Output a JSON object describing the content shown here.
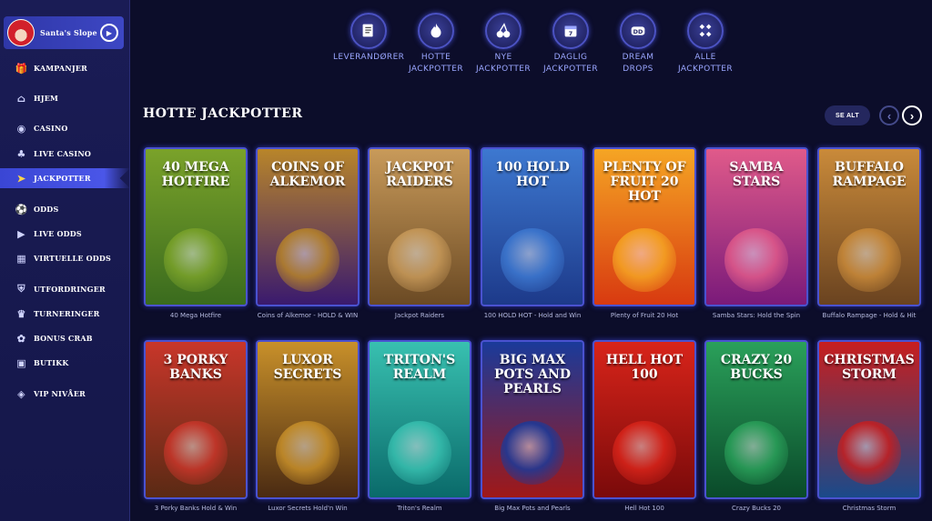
{
  "user": {
    "name": "Santa's Slope"
  },
  "sidebar": {
    "items": [
      {
        "label": "KAMPANJER",
        "icon": "gift-icon"
      },
      {
        "label": "HJEM",
        "icon": "home-icon"
      },
      {
        "label": "CASINO",
        "icon": "casino-chip-icon"
      },
      {
        "label": "LIVE CASINO",
        "icon": "live-casino-icon"
      },
      {
        "label": "JACKPOTTER",
        "icon": "jackpot-icon",
        "active": true
      },
      {
        "label": "ODDS",
        "icon": "football-icon"
      },
      {
        "label": "LIVE ODDS",
        "icon": "play-icon"
      },
      {
        "label": "VIRTUELLE ODDS",
        "icon": "virtual-icon"
      },
      {
        "label": "UTFORDRINGER",
        "icon": "shield-icon"
      },
      {
        "label": "TURNERINGER",
        "icon": "trophy-icon"
      },
      {
        "label": "BONUS CRAB",
        "icon": "crab-icon"
      },
      {
        "label": "BUTIKK",
        "icon": "shop-icon"
      },
      {
        "label": "VIP NIVÅER",
        "icon": "vip-icon"
      }
    ]
  },
  "categories": [
    {
      "label_1": "LEVERANDØRER",
      "label_2": "",
      "icon": "provider-icon"
    },
    {
      "label_1": "HOTTE",
      "label_2": "JACKPOTTER",
      "icon": "flame-icon"
    },
    {
      "label_1": "NYE",
      "label_2": "JACKPOTTER",
      "icon": "cherries-icon"
    },
    {
      "label_1": "DAGLIG",
      "label_2": "JACKPOTTER",
      "icon": "calendar-icon"
    },
    {
      "label_1": "DREAM",
      "label_2": "DROPS",
      "icon": "dream-drops-icon"
    },
    {
      "label_1": "ALLE",
      "label_2": "JACKPOTTER",
      "icon": "grid-icon"
    }
  ],
  "section": {
    "title": "HOTTE JACKPOTTER",
    "see_all": "SE ALT"
  },
  "games_row1": [
    {
      "title": "40 MEGA HOTFIRE",
      "caption": "40 Mega Hotfire",
      "color1": "#3a6b1e",
      "color2": "#7aa22a"
    },
    {
      "title": "COINS OF ALKEMOR",
      "caption": "Coins of Alkemor - HOLD & WIN",
      "color1": "#3a1a6e",
      "color2": "#b8852a"
    },
    {
      "title": "JACKPOT RAIDERS",
      "caption": "Jackpot Raiders",
      "color1": "#6b4a24",
      "color2": "#c89a5a"
    },
    {
      "title": "100 HOLD HOT",
      "caption": "100 HOLD HOT - Hold and Win",
      "color1": "#1d3a8a",
      "color2": "#3d78d0"
    },
    {
      "title": "PLENTY OF FRUIT 20 HOT",
      "caption": "Plenty of Fruit 20 Hot",
      "color1": "#d83a10",
      "color2": "#f5a524"
    },
    {
      "title": "SAMBA STARS",
      "caption": "Samba Stars: Hold the Spin",
      "color1": "#7a1a7a",
      "color2": "#e05a8a"
    },
    {
      "title": "BUFFALO RAMPAGE",
      "caption": "Buffalo Rampage - Hold & Hit",
      "color1": "#6a4320",
      "color2": "#c98a3a"
    }
  ],
  "games_row2": [
    {
      "title": "3 PORKY BANKS",
      "caption": "3 Porky Banks Hold & Win",
      "color1": "#5a2a14",
      "color2": "#c8362a"
    },
    {
      "title": "LUXOR SECRETS",
      "caption": "Luxor Secrets Hold'n Win",
      "color1": "#4a2a12",
      "color2": "#c8902a"
    },
    {
      "title": "TRITON'S REALM",
      "caption": "Triton's Realm",
      "color1": "#0a6a6a",
      "color2": "#38c0b0"
    },
    {
      "title": "BIG MAX POTS AND PEARLS",
      "caption": "Big Max Pots and Pearls",
      "color1": "#a01818",
      "color2": "#1a3a9a"
    },
    {
      "title": "HELL HOT 100",
      "caption": "Hell Hot 100",
      "color1": "#7a0a0a",
      "color2": "#d8241a"
    },
    {
      "title": "CRAZY 20 BUCKS",
      "caption": "Crazy Bucks 20",
      "color1": "#0a4a2a",
      "color2": "#2aa05a"
    },
    {
      "title": "CHRISTMAS STORM",
      "caption": "Christmas Storm",
      "color1": "#1a4a8a",
      "color2": "#c81e1e"
    }
  ]
}
